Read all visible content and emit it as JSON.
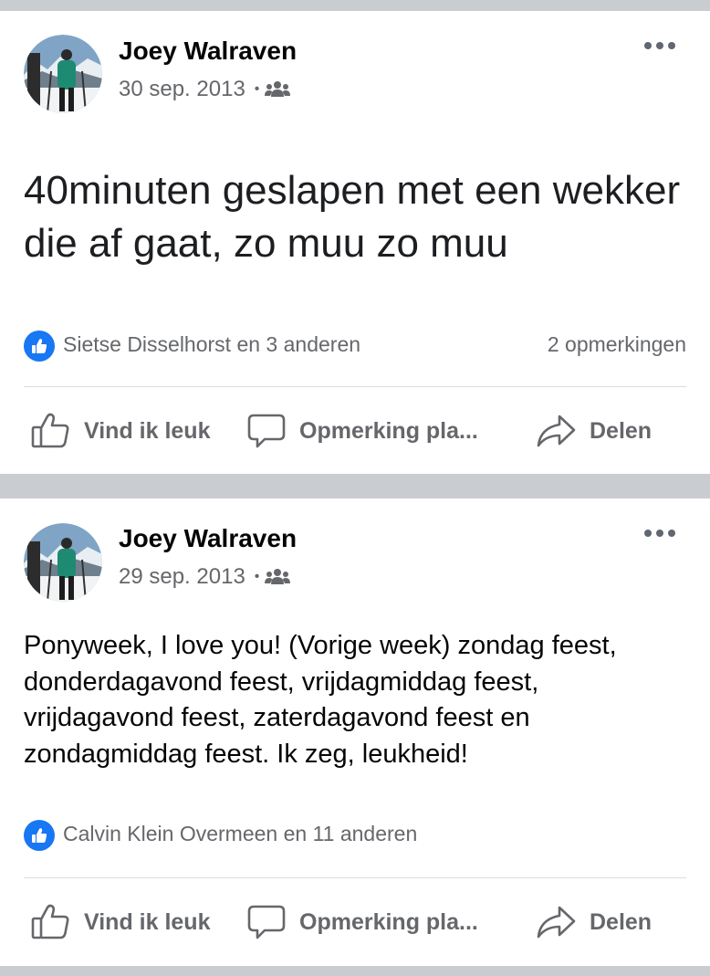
{
  "colors": {
    "feed_background": "#c9ccd1",
    "card_background": "#ffffff",
    "secondary_text": "#65676b",
    "like_blue": "#1877f2"
  },
  "icons": {
    "more": "more-dots-icon",
    "audience": "friends-group-icon",
    "reaction": "like-reaction-icon",
    "like": "thumbs-up-icon",
    "comment": "comment-bubble-icon",
    "share": "share-arrow-icon"
  },
  "posts": [
    {
      "author": "Joey Walraven",
      "date": "30 sep. 2013",
      "separator": "•",
      "text": "40minuten geslapen met een wekker die af gaat, zo muu zo muu",
      "reactors": "Sietse Disselhorst en 3 anderen",
      "comments": "2 opmerkingen",
      "actions": {
        "like": "Vind ik leuk",
        "comment": "Opmerking pla...",
        "share": "Delen"
      }
    },
    {
      "author": "Joey Walraven",
      "date": "29 sep. 2013",
      "separator": "•",
      "text": "Ponyweek, I love you! (Vorige week) zondag feest, donderdagavond feest,  vrijdagmiddag feest, vrijdagavond feest, zaterdagavond feest en zondagmiddag feest. Ik zeg, leukheid!",
      "reactors": "Calvin Klein Overmeen en 11 anderen",
      "actions": {
        "like": "Vind ik leuk",
        "comment": "Opmerking pla...",
        "share": "Delen"
      }
    }
  ]
}
